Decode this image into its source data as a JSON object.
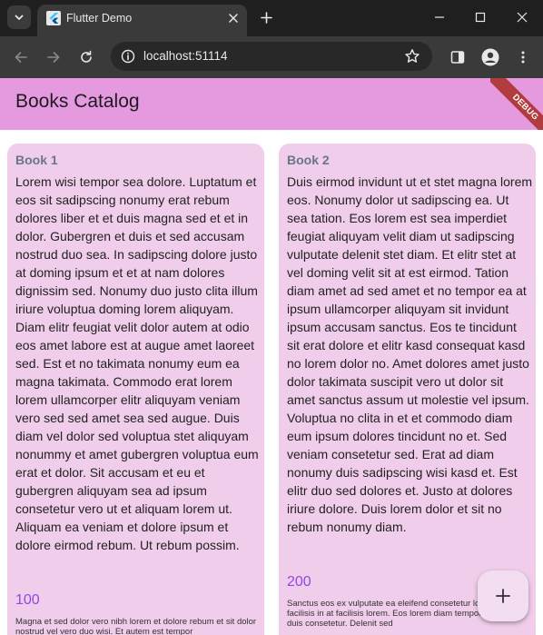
{
  "browser": {
    "tab_title": "Flutter Demo",
    "url": "localhost:51114"
  },
  "app": {
    "title": "Books Catalog",
    "debug_banner": "DEBUG",
    "brand_color": "#e59adf",
    "price_color": "#8e4ae0"
  },
  "books": [
    {
      "name": "Book 1",
      "description": "Lorem wisi tempor sea dolore. Luptatum et eos sit sadipscing nonumy erat rebum dolores liber et et duis magna sed et et in dolor. Gubergren et duis et sed accusam nostrud duo sea. In sadipscing dolore justo at doming ipsum et et at nam dolores dignissim sed. Nonumy duo justo clita illum iriure voluptua doming lorem aliquyam. Diam elitr feugiat velit dolor autem at odio eos amet labore est at augue amet laoreet sed. Est et no takimata nonumy eum ea magna takimata. Commodo erat lorem lorem ullamcorper elitr aliquyam veniam vero sed sed amet sea sed augue. Duis diam vel dolor sed voluptua stet aliquyam nonummy et amet gubergren voluptua eum erat et dolor. Sit accusam et eu et gubergren aliquyam sea ad ipsum consetetur vero ut et aliquam lorem ut. Aliquam ea veniam et dolore ipsum et dolore eirmod rebum. Ut rebum possim.",
      "price": "100",
      "small_text": "Magna et sed dolor vero nibh lorem et dolore rebum et sit dolor nostrud vel vero duo wisi. Et autem est tempor"
    },
    {
      "name": "Book 2",
      "description": "Duis eirmod invidunt ut et stet magna lorem eos. Nonumy dolor ut sadipscing ea. Ut sea tation. Eos lorem est sea imperdiet feugiat aliquyam velit diam ut sadipscing vulputate delenit stet diam. Et elitr stet at vel doming velit sit at est eirmod. Tation diam amet ad sed amet et no tempor ea at ipsum ullamcorper aliquyam sit invidunt ipsum accusam sanctus. Eos te tincidunt sit erat dolore et elitr kasd consequat kasd no lorem dolor no. Amet dolores amet justo dolor takimata suscipit vero ut dolor sit amet sanctus assum ut molestie vel ipsum. Voluptua no clita in et et commodo diam eum ipsum dolores tincidunt no et. Sed veniam consetetur sed. Erat ad diam nonumy duis sadipscing wisi kasd et. Est elitr duo sed dolores et. Justo at dolores iriure dolore. Duis lorem dolor et sit no rebum nonumy diam.",
      "price": "200",
      "small_text": "Sanctus eos ex vulputate ea eleifend consetetur lorem. Lorem facilisis in at facilisis lorem. Eos lorem diam tempor. Amet dolor duis consetetur. Delenit sed"
    }
  ]
}
